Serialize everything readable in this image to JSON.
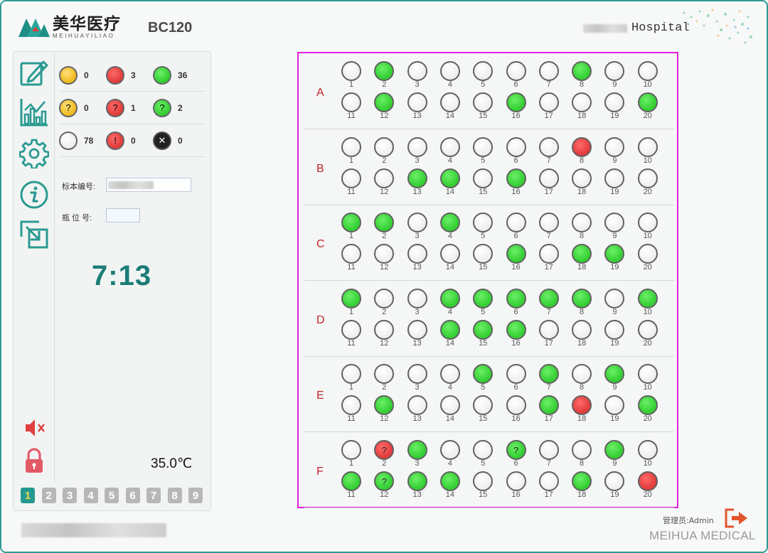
{
  "header": {
    "brand_cn": "美华医疗",
    "brand_pinyin": "MEIHUAYILIAO",
    "model": "BC120",
    "hospital": "Hospital"
  },
  "status_legend": [
    [
      {
        "state": "yellow",
        "symbol": "",
        "count": "0"
      },
      {
        "state": "red",
        "symbol": "",
        "count": "3"
      },
      {
        "state": "green",
        "symbol": "",
        "count": "36"
      }
    ],
    [
      {
        "state": "yellow",
        "symbol": "?",
        "count": "0"
      },
      {
        "state": "red",
        "symbol": "?",
        "count": "1"
      },
      {
        "state": "green",
        "symbol": "?",
        "count": "2"
      }
    ],
    [
      {
        "state": "white",
        "symbol": "",
        "count": "78"
      },
      {
        "state": "red",
        "symbol": "!",
        "count": "0"
      },
      {
        "state": "black",
        "symbol": "✕",
        "count": "0"
      }
    ]
  ],
  "form": {
    "specimen_label": "标本编号:",
    "bottle_label": "瓶 位 号:"
  },
  "timer": "7:13",
  "temperature": "35.0℃",
  "pager": [
    "1",
    "2",
    "3",
    "4",
    "5",
    "6",
    "7",
    "8",
    "9"
  ],
  "pager_active": 0,
  "footer": {
    "admin": "管理员:Admin",
    "brand_en": "MEIHUA MEDICAL"
  },
  "icons": {
    "side": [
      "edit-icon",
      "chart-icon",
      "settings-icon",
      "info-icon",
      "export-icon"
    ],
    "mute": "mute-icon",
    "lock": "lock-icon",
    "exit": "exit-icon"
  },
  "colors": {
    "accent": "#24998f",
    "green": "#34cf33",
    "red": "#e33c3c",
    "yellow": "#f1bb20",
    "frame": "#e020dd",
    "row_label": "#c0262d"
  },
  "rows": [
    {
      "label": "A",
      "wells": [
        "w",
        "g",
        "w",
        "w",
        "w",
        "w",
        "w",
        "g",
        "w",
        "w",
        "w",
        "g",
        "w",
        "w",
        "w",
        "g",
        "w",
        "w",
        "w",
        "g"
      ]
    },
    {
      "label": "B",
      "wells": [
        "w",
        "w",
        "w",
        "w",
        "w",
        "w",
        "w",
        "r",
        "w",
        "w",
        "w",
        "w",
        "g",
        "g",
        "w",
        "g",
        "w",
        "w",
        "w",
        "w"
      ]
    },
    {
      "label": "C",
      "wells": [
        "g",
        "g",
        "w",
        "g",
        "w",
        "w",
        "w",
        "w",
        "w",
        "w",
        "w",
        "w",
        "w",
        "w",
        "w",
        "g",
        "w",
        "g",
        "g",
        "w"
      ]
    },
    {
      "label": "D",
      "wells": [
        "g",
        "w",
        "w",
        "g",
        "g",
        "g",
        "g",
        "g",
        "w",
        "g",
        "w",
        "w",
        "w",
        "g",
        "g",
        "g",
        "w",
        "w",
        "w",
        "w"
      ]
    },
    {
      "label": "E",
      "wells": [
        "w",
        "w",
        "w",
        "w",
        "g",
        "w",
        "g",
        "w",
        "g",
        "w",
        "w",
        "g",
        "w",
        "w",
        "w",
        "w",
        "g",
        "r",
        "w",
        "g"
      ]
    },
    {
      "label": "F",
      "wells": [
        "w",
        "r?",
        "g",
        "w",
        "w",
        "g?",
        "w",
        "w",
        "g",
        "w",
        "g",
        "g?",
        "g",
        "g",
        "w",
        "w",
        "w",
        "g",
        "w",
        "r"
      ]
    }
  ]
}
